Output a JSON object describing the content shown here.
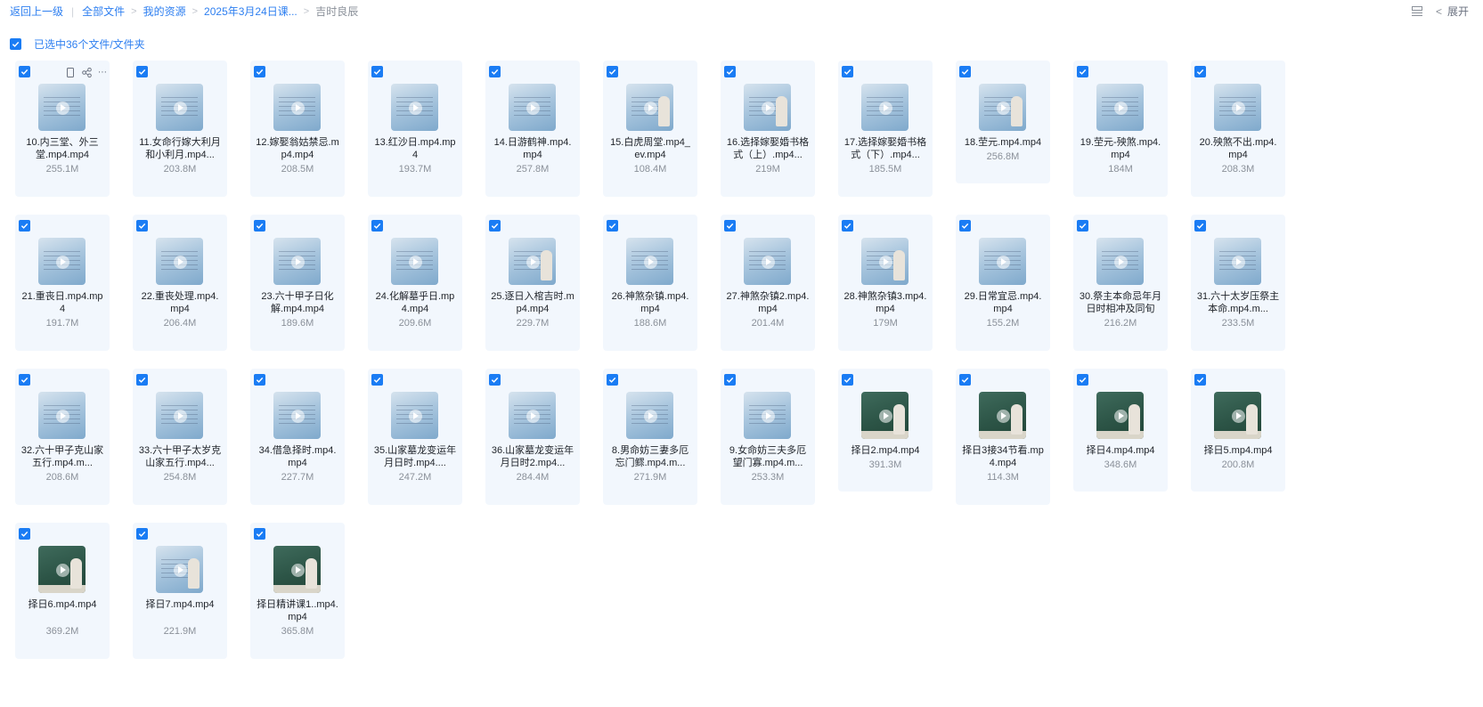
{
  "breadcrumb": {
    "back": "返回上一级",
    "items": [
      "全部文件",
      "我的资源",
      "2025年3月24日课...",
      "吉时良辰"
    ]
  },
  "toolbar": {
    "expand_label": "展开",
    "view_icon": "list-view-icon"
  },
  "selection": {
    "text": "已选中36个文件/文件夹",
    "checked": true
  },
  "colors": {
    "accent": "#1a7cf4",
    "tile_bg": "#f2f7fd"
  },
  "files": [
    {
      "name": "10.内三堂、外三堂.mp4.mp4",
      "size": "255.1M",
      "thumb": "board"
    },
    {
      "name": "11.女命行嫁大利月和小利月.mp4...",
      "size": "203.8M",
      "thumb": "board"
    },
    {
      "name": "12.嫁娶翁姑禁忌.mp4.mp4",
      "size": "208.5M",
      "thumb": "board"
    },
    {
      "name": "13.红沙日.mp4.mp4",
      "size": "193.7M",
      "thumb": "board"
    },
    {
      "name": "14.日游鹤神.mp4.mp4",
      "size": "257.8M",
      "thumb": "board"
    },
    {
      "name": "15.白虎周堂.mp4_ev.mp4",
      "size": "108.4M",
      "thumb": "board"
    },
    {
      "name": "16.选择嫁娶婚书格式（上）.mp4...",
      "size": "219M",
      "thumb": "board"
    },
    {
      "name": "17.选择嫁娶婚书格式（下）.mp4...",
      "size": "185.5M",
      "thumb": "board"
    },
    {
      "name": "18.茔元.mp4.mp4",
      "size": "256.8M",
      "thumb": "board"
    },
    {
      "name": "19.茔元-殃煞.mp4.mp4",
      "size": "184M",
      "thumb": "board"
    },
    {
      "name": "20.殃煞不出.mp4.mp4",
      "size": "208.3M",
      "thumb": "board"
    },
    {
      "name": "21.重丧日.mp4.mp4",
      "size": "191.7M",
      "thumb": "board"
    },
    {
      "name": "22.重丧处理.mp4.mp4",
      "size": "206.4M",
      "thumb": "board"
    },
    {
      "name": "23.六十甲子日化解.mp4.mp4",
      "size": "189.6M",
      "thumb": "board"
    },
    {
      "name": "24.化解墓乎日.mp4.mp4",
      "size": "209.6M",
      "thumb": "board"
    },
    {
      "name": "25.逐日入棺吉时.mp4.mp4",
      "size": "229.7M",
      "thumb": "board"
    },
    {
      "name": "26.神煞杂镇.mp4.mp4",
      "size": "188.6M",
      "thumb": "board"
    },
    {
      "name": "27.神煞杂镇2.mp4.mp4",
      "size": "201.4M",
      "thumb": "board"
    },
    {
      "name": "28.神煞杂镇3.mp4.mp4",
      "size": "179M",
      "thumb": "board"
    },
    {
      "name": "29.日常宜忌.mp4.mp4",
      "size": "155.2M",
      "thumb": "board"
    },
    {
      "name": "30.祭主本命忌年月日时相冲及同旬",
      "size": "216.2M",
      "thumb": "board"
    },
    {
      "name": "31.六十太岁压祭主本命.mp4.m...",
      "size": "233.5M",
      "thumb": "board"
    },
    {
      "name": "32.六十甲子克山家五行.mp4.m...",
      "size": "208.6M",
      "thumb": "board"
    },
    {
      "name": "33.六十甲子太岁克山家五行.mp4...",
      "size": "254.8M",
      "thumb": "board"
    },
    {
      "name": "34.借急择时.mp4.mp4",
      "size": "227.7M",
      "thumb": "board"
    },
    {
      "name": "35.山家墓龙变运年月日时.mp4....",
      "size": "247.2M",
      "thumb": "board"
    },
    {
      "name": "36.山家墓龙变运年月日时2.mp4...",
      "size": "284.4M",
      "thumb": "board"
    },
    {
      "name": "8.男命妨三妻多厄忘门鳏.mp4.m...",
      "size": "271.9M",
      "thumb": "board"
    },
    {
      "name": "9.女命妨三夫多厄望门寡.mp4.m...",
      "size": "253.3M",
      "thumb": "board"
    },
    {
      "name": "择日2.mp4.mp4",
      "size": "391.3M",
      "thumb": "green"
    },
    {
      "name": "择日3接34节看.mp4.mp4",
      "size": "114.3M",
      "thumb": "green"
    },
    {
      "name": "择日4.mp4.mp4",
      "size": "348.6M",
      "thumb": "green"
    },
    {
      "name": "择日5.mp4.mp4",
      "size": "200.8M",
      "thumb": "green"
    },
    {
      "name": "择日6.mp4.mp4",
      "size": "369.2M",
      "thumb": "green"
    },
    {
      "name": "择日7.mp4.mp4",
      "size": "221.9M",
      "thumb": "board"
    },
    {
      "name": "择日精讲课1..mp4.mp4",
      "size": "365.8M",
      "thumb": "green"
    }
  ]
}
